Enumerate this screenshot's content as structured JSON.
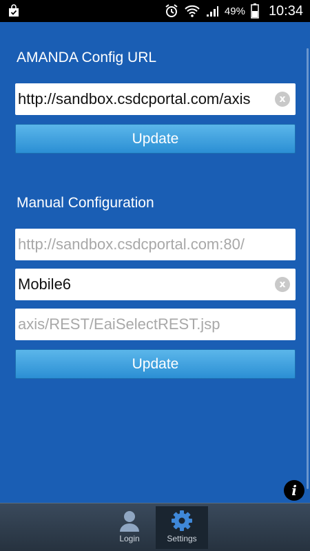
{
  "statusbar": {
    "battery_percent": "49%",
    "time": "10:34"
  },
  "config_section": {
    "title": "AMANDA Config URL",
    "url_value": "http://sandbox.csdcportal.com/axis",
    "update_label": "Update"
  },
  "manual_section": {
    "title": "Manual Configuration",
    "host_placeholder": "http://sandbox.csdcportal.com:80/",
    "site_value": "Mobile6",
    "path_placeholder": "axis/REST/EaiSelectREST.jsp",
    "update_label": "Update"
  },
  "tabs": [
    {
      "label": "Login",
      "icon": "user-icon",
      "active": false
    },
    {
      "label": "Settings",
      "icon": "gear-icon",
      "active": true
    }
  ],
  "clear_glyph": "x",
  "info_glyph": "i"
}
